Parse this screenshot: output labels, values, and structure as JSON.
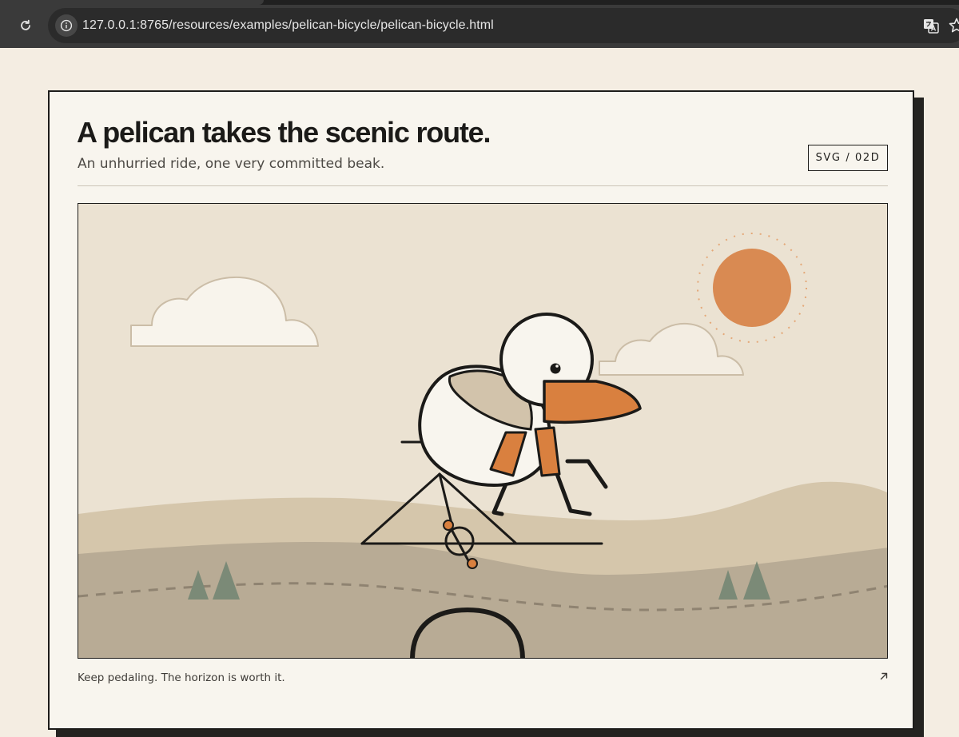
{
  "browser": {
    "url": "127.0.0.1:8765/resources/examples/pelican-bicycle/pelican-bicycle.html",
    "icons": [
      "reload-icon",
      "info-icon",
      "translate-icon",
      "star-icon"
    ]
  },
  "card": {
    "title": "A pelican takes the scenic route.",
    "subtitle": "An unhurried ride, one very committed beak.",
    "badge": "SVG / 02D",
    "caption": "Keep pedaling. The horizon is worth it.",
    "link_icon": "arrow-up-right-icon"
  },
  "colors": {
    "page_bg": "#f4ede2",
    "card_bg": "#f8f5ee",
    "ink": "#1b1a18",
    "sky": "#ebe2d2",
    "hill_far": "#d5c6ab",
    "hill_near": "#b8ab95",
    "sun": "#d98a52",
    "beak": "#d9803f",
    "tree": "#7b8a77",
    "cloud": "#f8f4ec"
  }
}
